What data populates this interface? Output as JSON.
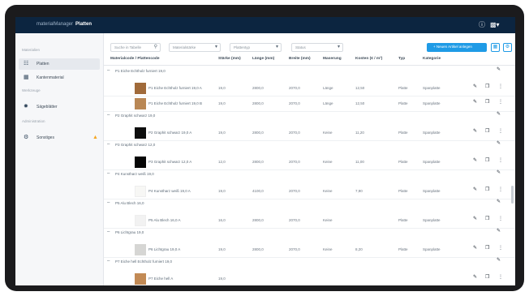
{
  "app": {
    "title": "materialManager",
    "section": "Platten"
  },
  "topbar": {
    "help_icon": "help-icon",
    "language_icon": "flag-de-icon"
  },
  "sidebar": {
    "sections": [
      {
        "label": "Materialien",
        "items": [
          {
            "label": "Platten",
            "icon": "layers-icon",
            "active": true
          },
          {
            "label": "Kantenmaterial",
            "icon": "edge-material-icon"
          }
        ]
      },
      {
        "label": "Werkzeuge",
        "items": [
          {
            "label": "Sägeblätter",
            "icon": "saw-blade-icon"
          }
        ]
      },
      {
        "label": "Administration",
        "items": [
          {
            "label": "Sonstiges",
            "icon": "settings-icon",
            "warning": true
          }
        ]
      }
    ]
  },
  "filters": {
    "search_placeholder": "Suche in Tabelle",
    "thickness": "Materialstärke",
    "material": "Plattentyp",
    "status": "Status"
  },
  "toolbar": {
    "new_button": "+ Neuen Artikel anlegen",
    "grid_icon": "grid-icon",
    "settings_icon": "gear-icon"
  },
  "table": {
    "columns": [
      "Materialcode / Plattencode",
      "Stärke (mm)",
      "Länge (mm)",
      "Breite (mm)",
      "Maserung",
      "Kosten (€ / m²)",
      "Typ",
      "Kategorie"
    ],
    "groups": [
      {
        "name": "P1 Eiche Echtholz furniert 19,0",
        "items": [
          {
            "name": "P1 Eiche Echtholz furniert 19,0 A",
            "thickness": "19,0",
            "length": "2800,0",
            "width": "2070,0",
            "grain": "Länge",
            "cost": "12,50",
            "type": "Platte",
            "category": "Spanplatte",
            "swatch": "#a06a3a"
          },
          {
            "name": "P1 Eiche Echtholz furniert 19,0 B",
            "thickness": "19,0",
            "length": "2800,0",
            "width": "2070,0",
            "grain": "Länge",
            "cost": "12,50",
            "type": "Platte",
            "category": "Spanplatte",
            "swatch": "#b98755"
          }
        ]
      },
      {
        "name": "P2 Graphit schwarz 19,0",
        "items": [
          {
            "name": "P2 Graphit schwarz 19,0 A",
            "thickness": "19,0",
            "length": "2800,0",
            "width": "2070,0",
            "grain": "Keine",
            "cost": "11,20",
            "type": "Platte",
            "category": "Spanplatte",
            "swatch": "#0d0d0d"
          }
        ]
      },
      {
        "name": "P3 Graphit schwarz 12,0",
        "items": [
          {
            "name": "P3 Graphit schwarz 12,0 A",
            "thickness": "12,0",
            "length": "2800,0",
            "width": "2070,0",
            "grain": "Keine",
            "cost": "11,00",
            "type": "Platte",
            "category": "Spanplatte",
            "swatch": "#050505"
          }
        ]
      },
      {
        "name": "P4 Kunstharz weiß 19,0",
        "items": [
          {
            "name": "P4 Kunstharz weiß 19,0 A",
            "thickness": "19,0",
            "length": "4100,0",
            "width": "2070,0",
            "grain": "Keine",
            "cost": "7,90",
            "type": "Platte",
            "category": "Spanplatte",
            "swatch": "#f7f7f5"
          }
        ]
      },
      {
        "name": "P5 Alu Blech 16,0",
        "items": [
          {
            "name": "P5 Alu Blech 16,0 A",
            "thickness": "16,0",
            "length": "2800,0",
            "width": "2070,0",
            "grain": "Keine",
            "cost": "",
            "type": "Platte",
            "category": "Spanplatte",
            "swatch": "#f2f2f2"
          }
        ]
      },
      {
        "name": "P6 Lichtgrau 19,0",
        "items": [
          {
            "name": "P6 Lichtgrau 19,0 A",
            "thickness": "19,0",
            "length": "2800,0",
            "width": "2070,0",
            "grain": "Keine",
            "cost": "8,20",
            "type": "Platte",
            "category": "Spanplatte",
            "swatch": "#d6d6d4"
          }
        ]
      },
      {
        "name": "P7 Eiche hell Echtholz furniert 19,0",
        "items": [
          {
            "name": "P7 Eiche hell A",
            "thickness": "19,0",
            "length": "",
            "width": "",
            "grain": "",
            "cost": "",
            "type": "",
            "category": "",
            "swatch": "#c28a55"
          }
        ]
      }
    ]
  },
  "colors": {
    "topbar": "#0c2540",
    "accent": "#1f9be6",
    "warning": "#f5a623"
  }
}
